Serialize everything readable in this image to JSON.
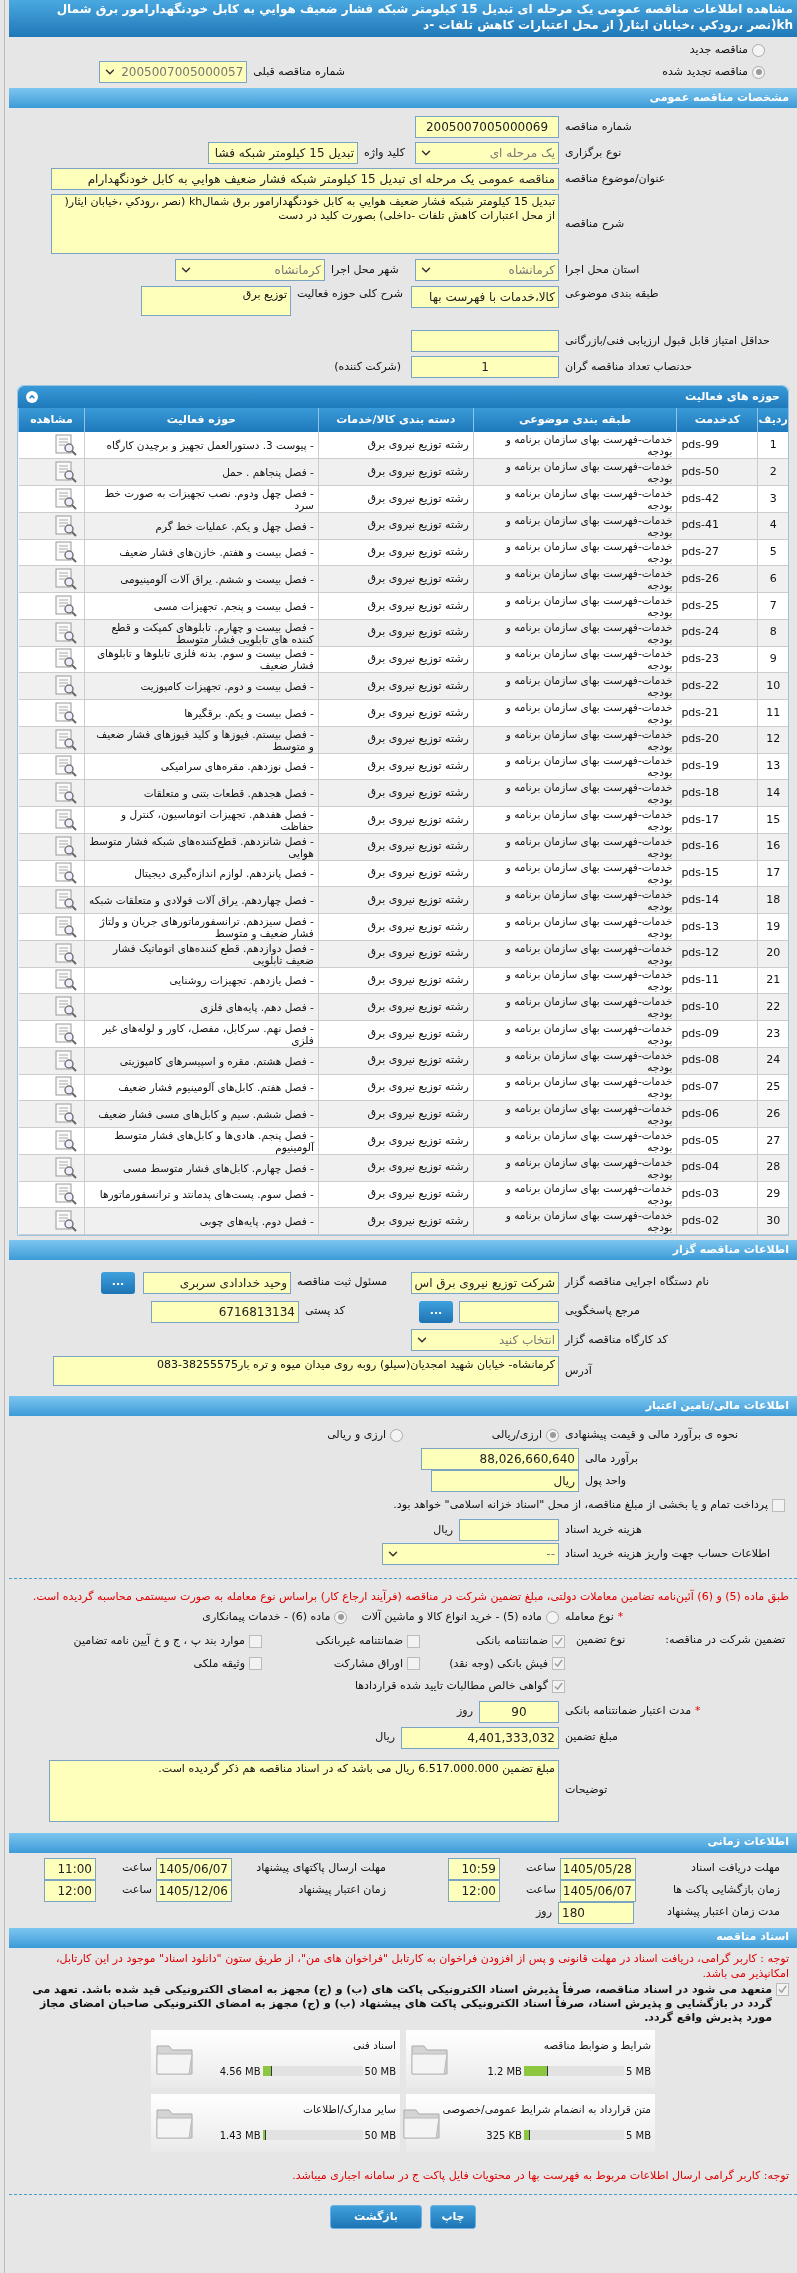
{
  "title": "مشاهده اطلاعات مناقصه عمومی یک مرحله ای تبدیل 15 کیلومتر شبکه فشار ضعیف هوایي به کابل خودنگهدارامور برق شمال kh(نصر ،رودکي ،خیابان ایثار( از محل اعتبارات کاهش تلفات -د",
  "tender_options": [
    {
      "label": "مناقصه جدید",
      "selected": false
    },
    {
      "label": "مناقصه تجدید شده",
      "selected": true
    }
  ],
  "previous_tender": {
    "label": "شماره مناقصه قبلی",
    "value": "2005007005000057"
  },
  "general": {
    "header": "مشخصات مناقصه عمومی",
    "tender_number": {
      "label": "شماره مناقصه",
      "value": "2005007005000069"
    },
    "holding_type": {
      "label": "نوع برگزاری",
      "value": "یک مرحله ای"
    },
    "keyword": {
      "label": "کلید واژه",
      "value": "تبدیل 15 کیلومتر شبکه فشا"
    },
    "subject": {
      "label": "عنوان/موضوع مناقصه",
      "value": "مناقصه عمومی یک مرحله ای تبدیل 15 کیلومتر شبکه فشار ضعیف هوایي به کابل خودنگهدارام"
    },
    "description": {
      "label": "شرح مناقصه",
      "value": "تبدیل 15 کیلومتر شبکه فشار ضعیف هوایي به کابل خودنگهدارامور برق شمالkh (نصر ،رودکي ،خیابان ایثار( از محل اعتبارات کاهش تلفات -داخلی) بصورت کلید در دست"
    },
    "province": {
      "label": "استان محل اجرا",
      "value": "کرمانشاه"
    },
    "city": {
      "label": "شهر محل اجرا",
      "value": "کرمانشاه"
    },
    "classification": {
      "label": "طبقه بندی موضوعی",
      "value": "کالا،خدمات با فهرست بها"
    },
    "activity_summary": {
      "label": "شرح کلی حوزه فعالیت",
      "value": "توزیع برق"
    },
    "min_score": {
      "label": "حداقل امتیاز قابل قبول ارزیابی فنی/بازرگانی"
    },
    "min_bidders": {
      "label": "حدنصاب تعداد مناقصه گران",
      "value": "1",
      "suffix": "(شرکت کننده)"
    }
  },
  "activities": {
    "header": "حوزه های فعالیت",
    "columns": [
      "ردیف",
      "کدخدمت",
      "طبقه بندی موضوعی",
      "دسته بندی کالا/خدمات",
      "حوزه فعالیت",
      "مشاهده"
    ],
    "rows": [
      {
        "row": "1",
        "code": "pds-99",
        "category": "خدمات-فهرست بهای سازمان برنامه و بودجه",
        "group": "رشته توزیع نیروی برق",
        "activity": "- پیوست 3. دستورالعمل تجهیز و برچیدن کارگاه"
      },
      {
        "row": "2",
        "code": "pds-50",
        "category": "خدمات-فهرست بهای سازمان برنامه و بودجه",
        "group": "رشته توزیع نیروی برق",
        "activity": "- فصل پنجاهم . حمل"
      },
      {
        "row": "3",
        "code": "pds-42",
        "category": "خدمات-فهرست بهای سازمان برنامه و بودجه",
        "group": "رشته توزیع نیروی برق",
        "activity": "- فصل چهل ودوم. نصب تجهیزات به صورت خط سرد"
      },
      {
        "row": "4",
        "code": "pds-41",
        "category": "خدمات-فهرست بهای سازمان برنامه و بودجه",
        "group": "رشته توزیع نیروی برق",
        "activity": "- فصل چهل و یکم. عملیات خط گرم"
      },
      {
        "row": "5",
        "code": "pds-27",
        "category": "خدمات-فهرست بهای سازمان برنامه و بودجه",
        "group": "رشته توزیع نیروی برق",
        "activity": "- فصل بیست و هفتم. خازن‌های فشار ضعیف"
      },
      {
        "row": "6",
        "code": "pds-26",
        "category": "خدمات-فهرست بهای سازمان برنامه و بودجه",
        "group": "رشته توزیع نیروی برق",
        "activity": "- فصل بیست و ششم. یراق آلات آلومینیومی"
      },
      {
        "row": "7",
        "code": "pds-25",
        "category": "خدمات-فهرست بهای سازمان برنامه و بودجه",
        "group": "رشته توزیع نیروی برق",
        "activity": "- فصل بیست و پنجم. تجهیزات مسی"
      },
      {
        "row": "8",
        "code": "pds-24",
        "category": "خدمات-فهرست بهای سازمان برنامه و بودجه",
        "group": "رشته توزیع نیروی برق",
        "activity": "- فصل بیست و چهارم. تابلوهای کمپکت و قطع کننده های تابلویی فشار متوسط"
      },
      {
        "row": "9",
        "code": "pds-23",
        "category": "خدمات-فهرست بهای سازمان برنامه و بودجه",
        "group": "رشته توزیع نیروی برق",
        "activity": "- فصل بیست و سوم. بدنه فلزی تابلوها و تابلوهای فشار ضعیف"
      },
      {
        "row": "10",
        "code": "pds-22",
        "category": "خدمات-فهرست بهای سازمان برنامه و بودجه",
        "group": "رشته توزیع نیروی برق",
        "activity": "- فصل بیست و دوم. تجهیزات کامپوزیت"
      },
      {
        "row": "11",
        "code": "pds-21",
        "category": "خدمات-فهرست بهای سازمان برنامه و بودجه",
        "group": "رشته توزیع نیروی برق",
        "activity": "- فصل بیست و یکم. برقگیرها"
      },
      {
        "row": "12",
        "code": "pds-20",
        "category": "خدمات-فهرست بهای سازمان برنامه و بودجه",
        "group": "رشته توزیع نیروی برق",
        "activity": "- فصل بیستم. فیوزها و کلید فیوزهای فشار ضعیف و متوسط"
      },
      {
        "row": "13",
        "code": "pds-19",
        "category": "خدمات-فهرست بهای سازمان برنامه و بودجه",
        "group": "رشته توزیع نیروی برق",
        "activity": "- فصل نوزدهم. مقره‌های سرامیکی"
      },
      {
        "row": "14",
        "code": "pds-18",
        "category": "خدمات-فهرست بهای سازمان برنامه و بودجه",
        "group": "رشته توزیع نیروی برق",
        "activity": "- فصل هجدهم. قطعات بتنی و متعلقات"
      },
      {
        "row": "15",
        "code": "pds-17",
        "category": "خدمات-فهرست بهای سازمان برنامه و بودجه",
        "group": "رشته توزیع نیروی برق",
        "activity": "- فصل هفدهم. تجهیزات اتوماسیون، کنترل و حفاظت"
      },
      {
        "row": "16",
        "code": "pds-16",
        "category": "خدمات-فهرست بهای سازمان برنامه و بودجه",
        "group": "رشته توزیع نیروی برق",
        "activity": "- فصل شانزدهم. قطع‌کننده‌های شبکه فشار متوسط هوایی"
      },
      {
        "row": "17",
        "code": "pds-15",
        "category": "خدمات-فهرست بهای سازمان برنامه و بودجه",
        "group": "رشته توزیع نیروی برق",
        "activity": "- فصل پانزدهم. لوازم اندازه‌گیری دیجیتال"
      },
      {
        "row": "18",
        "code": "pds-14",
        "category": "خدمات-فهرست بهای سازمان برنامه و بودجه",
        "group": "رشته توزیع نیروی برق",
        "activity": "- فصل چهاردهم. یراق آلات فولادی و متعلقات شبکه"
      },
      {
        "row": "19",
        "code": "pds-13",
        "category": "خدمات-فهرست بهای سازمان برنامه و بودجه",
        "group": "رشته توزیع نیروی برق",
        "activity": "- فصل سیزدهم. ترانسفورماتورهای جریان و ولتاژ فشار ضعیف و متوسط"
      },
      {
        "row": "20",
        "code": "pds-12",
        "category": "خدمات-فهرست بهای سازمان برنامه و بودجه",
        "group": "رشته توزیع نیروی برق",
        "activity": "- فصل دوازدهم. قطع کننده‌های اتوماتیک فشار ضعیف تابلویی"
      },
      {
        "row": "21",
        "code": "pds-11",
        "category": "خدمات-فهرست بهای سازمان برنامه و بودجه",
        "group": "رشته توزیع نیروی برق",
        "activity": "- فصل یازدهم. تجهیزات روشنایی"
      },
      {
        "row": "22",
        "code": "pds-10",
        "category": "خدمات-فهرست بهای سازمان برنامه و بودجه",
        "group": "رشته توزیع نیروی برق",
        "activity": "- فصل دهم. پایه‌های فلزی"
      },
      {
        "row": "23",
        "code": "pds-09",
        "category": "خدمات-فهرست بهای سازمان برنامه و بودجه",
        "group": "رشته توزیع نیروی برق",
        "activity": "- فصل نهم. سرکابل، مفصل، کاور و لوله‌های غیر فلزی"
      },
      {
        "row": "24",
        "code": "pds-08",
        "category": "خدمات-فهرست بهای سازمان برنامه و بودجه",
        "group": "رشته توزیع نیروی برق",
        "activity": "- فصل هشتم. مقره و اسپیسرهای کامپوزیتی"
      },
      {
        "row": "25",
        "code": "pds-07",
        "category": "خدمات-فهرست بهای سازمان برنامه و بودجه",
        "group": "رشته توزیع نیروی برق",
        "activity": "- فصل هفتم. کابل‌های آلومینیوم فشار ضعیف"
      },
      {
        "row": "26",
        "code": "pds-06",
        "category": "خدمات-فهرست بهای سازمان برنامه و بودجه",
        "group": "رشته توزیع نیروی برق",
        "activity": "- فصل ششم. سیم و کابل‌های مسی فشار ضعیف"
      },
      {
        "row": "27",
        "code": "pds-05",
        "category": "خدمات-فهرست بهای سازمان برنامه و بودجه",
        "group": "رشته توزیع نیروی برق",
        "activity": "- فصل پنجم. هادی‌ها و کابل‌های فشار متوسط آلومینیوم"
      },
      {
        "row": "28",
        "code": "pds-04",
        "category": "خدمات-فهرست بهای سازمان برنامه و بودجه",
        "group": "رشته توزیع نیروی برق",
        "activity": "- فصل چهارم. کابل‌های فشار متوسط مسی"
      },
      {
        "row": "29",
        "code": "pds-03",
        "category": "خدمات-فهرست بهای سازمان برنامه و بودجه",
        "group": "رشته توزیع نیروی برق",
        "activity": "- فصل سوم. پست‌های پدمانتد و ترانسفورماتورها"
      },
      {
        "row": "30",
        "code": "pds-02",
        "category": "خدمات-فهرست بهای سازمان برنامه و بودجه",
        "group": "رشته توزیع نیروی برق",
        "activity": "- فصل دوم. پایه‌های چوبی"
      }
    ]
  },
  "organizer": {
    "header": "اطلاعات مناقصه گزار",
    "org_name": {
      "label": "نام دستگاه اجرایی مناقصه گزار",
      "value": "شرکت توزیع نیروی برق اس"
    },
    "registrar": {
      "label": "مسئول ثبت مناقصه",
      "value": "وحید خدادادی سربری",
      "button": "..."
    },
    "reference": {
      "label": "مرجع پاسخگویی",
      "button": "..."
    },
    "postal_code": {
      "label": "کد پستی",
      "value": "6716813134"
    },
    "workshop_code": {
      "label": "کد کارگاه مناقصه گزار",
      "value": "انتخاب کنید"
    },
    "address": {
      "label": "آدرس",
      "value": "کرمانشاه- خیابان شهید امجدیان(سیلو) روبه روی میدان میوه و تره بار38255575-083"
    }
  },
  "finance": {
    "header": "اطلاعات مالی/تامین اعتبار",
    "estimate_method": {
      "label": "نحوه ی برآورد مالی و قیمت پیشنهادی",
      "options": [
        {
          "label": "ارزی/ریالی",
          "selected": true
        },
        {
          "label": "ارزی و ریالی",
          "selected": false
        }
      ]
    },
    "estimate": {
      "label": "برآورد مالی",
      "value": "88,026,660,640"
    },
    "currency": {
      "label": "واحد پول",
      "value": "ریال"
    },
    "treasury": {
      "label": "پرداخت تمام و یا بخشی از مبلغ مناقصه، از محل \"اسناد خزانه اسلامی\" خواهد بود.",
      "checked": false
    },
    "doc_fee": {
      "label": "هزینه خرید اسناد",
      "unit": "ریال"
    },
    "account": {
      "label": "اطلاعات حساب جهت واریز هزینه خرید اسناد",
      "value": "--"
    },
    "notice": "طبق ماده (5) و (6) آئین‌نامه تضامین معاملات دولتی، مبلغ تضمین شرکت در مناقصه (فرآیند ارجاع کار) براساس نوع معامله به صورت سیستمی محاسبه گردیده است.",
    "deal_type": {
      "label": "نوع معامله",
      "required_mark": "*",
      "options": [
        {
          "label": "ماده (5) - خرید انواع کالا و ماشین آلات",
          "selected": false
        },
        {
          "label": "ماده (6) - خدمات پیمانکاری",
          "selected": true
        }
      ]
    },
    "guarantee": {
      "label": "تضمین شرکت در مناقصه:",
      "type_label": "نوع تضمین",
      "options": [
        {
          "label": "ضمانتنامه بانکی",
          "checked": true
        },
        {
          "label": "ضمانتنامه غیربانکی",
          "checked": false
        },
        {
          "label": "موارد بند پ ، ج و خ آیین نامه تضامین",
          "checked": false
        },
        {
          "label": "فیش بانکی (وجه نقد)",
          "checked": true
        },
        {
          "label": "اوراق مشارکت",
          "checked": false
        },
        {
          "label": "وثیقه ملکی",
          "checked": false
        },
        {
          "label": "گواهی خالص مطالبات تایید شده قراردادها",
          "checked": true
        }
      ]
    },
    "validity": {
      "label": "مدت اعتبار ضمانتنامه بانکی",
      "required_mark": "*",
      "value": "90",
      "unit": "روز"
    },
    "amount": {
      "label": "مبلغ تضمین",
      "value": "4,401,333,032",
      "unit": "ریال"
    },
    "notes": {
      "label": "توضیحات",
      "value": "مبلغ تضمین 6.517.000.000 ریال می باشد که در اسناد مناقصه هم ذکر گردیده است."
    }
  },
  "timing": {
    "header": "اطلاعات زمانی",
    "items": [
      {
        "label": "مهلت دریافت اسناد",
        "date": "1405/05/28",
        "time_label": "ساعت",
        "time": "10:59"
      },
      {
        "label": "مهلت ارسال پاکتهای پیشنهاد",
        "date": "1405/06/07",
        "time_label": "ساعت",
        "time": "11:00"
      },
      {
        "label": "زمان بازگشایی پاکت ها",
        "date": "1405/06/07",
        "time_label": "ساعت",
        "time": "12:00"
      },
      {
        "label": "زمان اعتبار پیشنهاد",
        "date": "1405/12/06",
        "time_label": "ساعت",
        "time": "12:00"
      }
    ],
    "validity": {
      "label": "مدت زمان اعتبار پیشنهاد",
      "value": "180",
      "unit": "روز"
    }
  },
  "documents": {
    "header": "اسناد مناقصه",
    "notice": "توجه : کاربر گرامی، دریافت اسناد در مهلت قانونی و پس از افزودن فراخوان به کارتابل \"فراخوان های من\"، از طریق ستون \"دانلود اسناد\" موجود در این کارتابل، امکانپذیر می باشد.",
    "commitment": {
      "text": "متعهد می شود در اسناد مناقصه، صرفاً پذیرش اسناد الکترونیکی پاکت های (ب) و (ج) مجهز به امضای الکترونیکی قید شده باشد. تعهد می گردد در بازگشایی و پذیرش اسناد، صرفاً اسناد الکترونیکی پاکت های پیشنهاد (ب) و (ج) مجهز به امضای الکترونیکی صاحبان امضای مجاز مورد پذیرش واقع گردد.",
      "checked": true
    },
    "files": [
      {
        "title": "شرایط و ضوابط مناقصه",
        "size": "1.2 MB",
        "max": "5 MB",
        "level": 0.24
      },
      {
        "title": "اسناد فنی",
        "size": "4.56 MB",
        "max": "50 MB",
        "level": 0.09
      },
      {
        "title": "متن قرارداد به انضمام شرایط عمومی/خصوصی",
        "size": "325 KB",
        "max": "5 MB",
        "level": 0.065
      },
      {
        "title": "سایر مدارک/اطلاعات",
        "size": "1.43 MB",
        "max": "50 MB",
        "level": 0.03
      }
    ],
    "footer_notice": "توجه: کاربر گرامی ارسال اطلاعات مربوط به فهرست بها در محتویات فایل پاکت ج در سامانه اجباری میباشد."
  },
  "buttons": [
    "چاپ",
    "بازگشت"
  ]
}
